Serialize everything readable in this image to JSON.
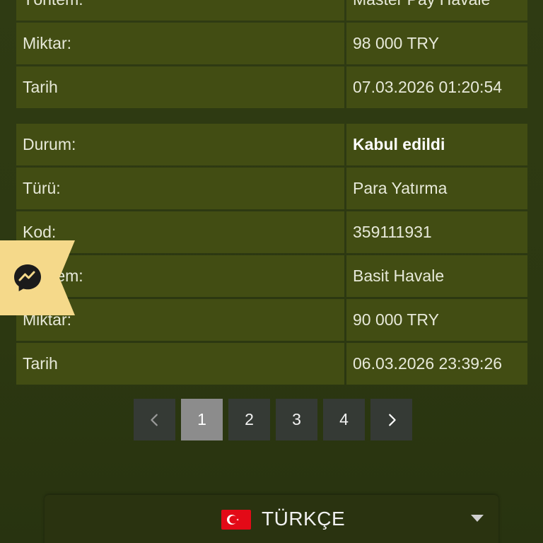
{
  "tables": [
    {
      "rows": [
        {
          "label": "Yöntem:",
          "value": "Master Pay Havale"
        },
        {
          "label": "Miktar:",
          "value": "98 000 TRY"
        },
        {
          "label": "Tarih",
          "value": "07.03.2026 01:20:54"
        }
      ]
    },
    {
      "rows": [
        {
          "label": "Durum:",
          "value": "Kabul edildi"
        },
        {
          "label": "Türü:",
          "value": "Para Yatırma"
        },
        {
          "label": "Kod:",
          "value": "359111931"
        },
        {
          "label": "Yöntem:",
          "value": "Basit Havale"
        },
        {
          "label": "Miktar:",
          "value": "90 000 TRY"
        },
        {
          "label": "Tarih",
          "value": "06.03.2026 23:39:26"
        }
      ]
    }
  ],
  "pagination": {
    "prev_icon": "chevron-left-icon",
    "next_icon": "chevron-right-icon",
    "pages": [
      "1",
      "2",
      "3",
      "4"
    ],
    "current_page": "1"
  },
  "language_selector": {
    "label": "TÜRKÇE",
    "flag_icon": "turkey-flag-icon",
    "caret_icon": "caret-down-icon"
  },
  "chat_widget": {
    "icon": "messenger-icon",
    "accent_color": "#f5d98a"
  },
  "colors": {
    "background": "#2e3a12",
    "cell_background": "#424d13",
    "pagination_button": "#353a35",
    "pagination_active": "#8c8c8c"
  }
}
